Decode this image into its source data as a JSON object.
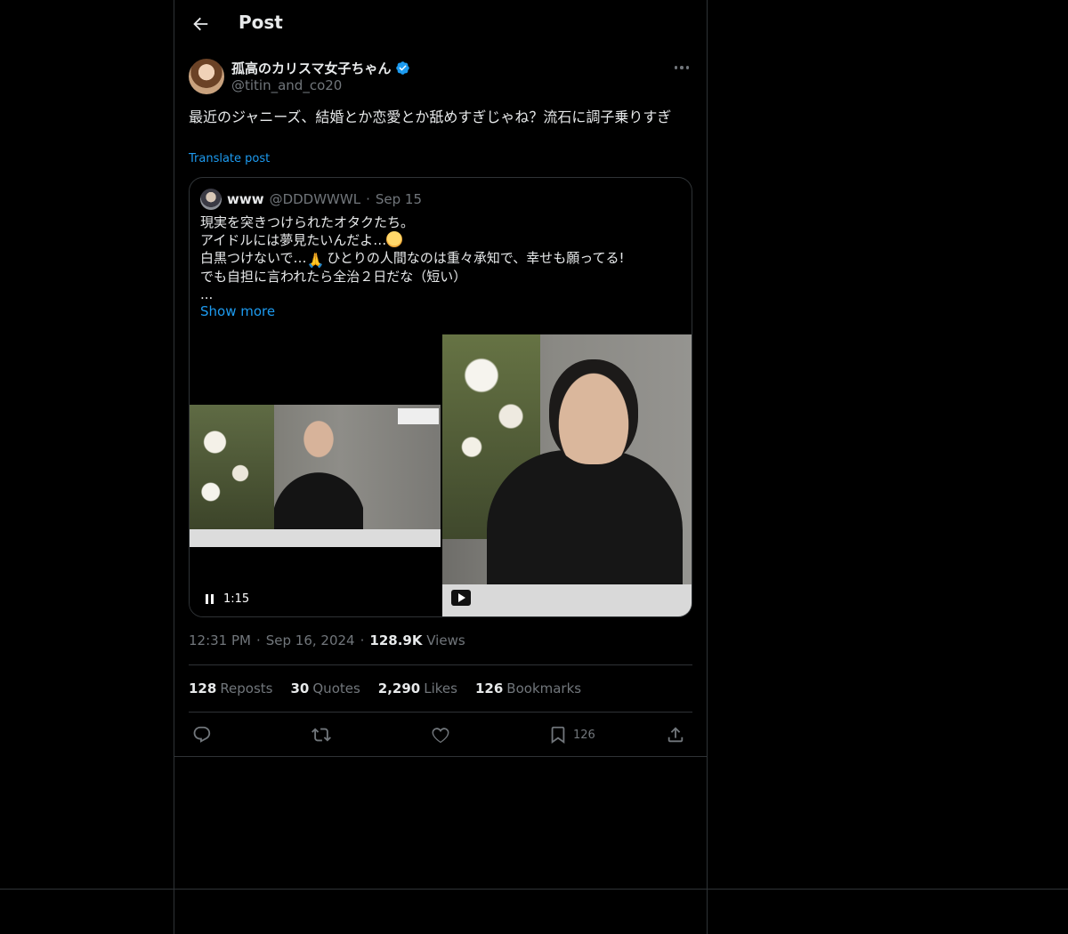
{
  "header": {
    "title": "Post"
  },
  "post": {
    "author": {
      "name": "孤高のカリスマ女子ちゃん",
      "handle": "@titin_and_co20",
      "verified": true
    },
    "text": "最近のジャニーズ、結婚とか恋愛とか舐めすぎじゃね？流石に調子乗りすぎ",
    "translate_label": "Translate post",
    "time": "12:31 PM",
    "date": "Sep 16, 2024",
    "views_count": "128.9K",
    "views_label": "Views",
    "separator": "·"
  },
  "quote": {
    "name": "www",
    "handle": "@DDDWWWL",
    "separator": "·",
    "date": "Sep 15",
    "lines": [
      "現実を突きつけられたオタクたち。",
      "アイドルには夢見たいんだよ…",
      "白黒つけないで…",
      " ひとりの人間なのは重々承知で、幸せも願ってる!",
      "でも自担に言われたら全治２日だな（短い）",
      "..."
    ],
    "show_more": "Show more",
    "video": {
      "duration": "1:15"
    }
  },
  "stats": {
    "reposts": {
      "count": "128",
      "label": "Reposts"
    },
    "quotes": {
      "count": "30",
      "label": "Quotes"
    },
    "likes": {
      "count": "2,290",
      "label": "Likes"
    },
    "bookmarks": {
      "count": "126",
      "label": "Bookmarks"
    }
  },
  "actions": {
    "bookmark_count": "126"
  },
  "colors": {
    "accent": "#1d9bf0",
    "text": "#e7e9ea",
    "muted": "#71767b",
    "border": "#2f3336",
    "background": "#000000"
  },
  "icons": [
    "back-arrow-icon",
    "verified-badge-icon",
    "more-options-icon",
    "pause-icon",
    "play-icon",
    "reply-icon",
    "repost-icon",
    "like-icon",
    "bookmark-icon",
    "share-icon"
  ]
}
